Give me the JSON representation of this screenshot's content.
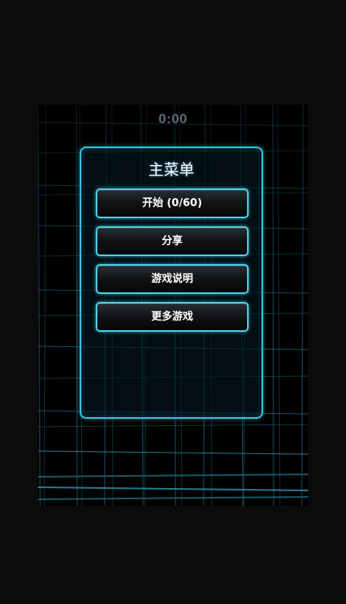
{
  "game": {
    "timer": "0:00"
  },
  "menu": {
    "title": "主菜单",
    "buttons": [
      {
        "label": "开始 (0/60)"
      },
      {
        "label": "分享"
      },
      {
        "label": "游戏说明"
      },
      {
        "label": "更多游戏"
      }
    ]
  },
  "theme": {
    "accent": "#36c3db",
    "grid_line": "#1f6f80",
    "background": "#0b0b0b"
  }
}
